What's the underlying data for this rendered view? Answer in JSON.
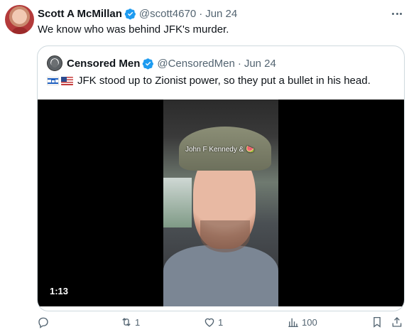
{
  "tweet": {
    "author_name": "Scott A McMillan",
    "author_handle": "@scott4670",
    "separator": "·",
    "date": "Jun 24",
    "text": "We know who was behind JFK's murder."
  },
  "quoted": {
    "author_name": "Censored Men",
    "author_handle": "@CensoredMen",
    "separator": "·",
    "date": "Jun 24",
    "flags": [
      "israel-flag",
      "us-flag"
    ],
    "text": "JFK stood up to Zionist power, so they put a bullet in his head.",
    "video": {
      "overlay_text": "John F Kennedy & 🍉",
      "duration": "1:13"
    }
  },
  "actions": {
    "reply_count": "",
    "repost_count": "1",
    "like_count": "1",
    "views_count": "100"
  },
  "colors": {
    "text": "#0f1419",
    "muted": "#536471",
    "verified": "#1d9bf0",
    "border": "#cfd9de"
  }
}
